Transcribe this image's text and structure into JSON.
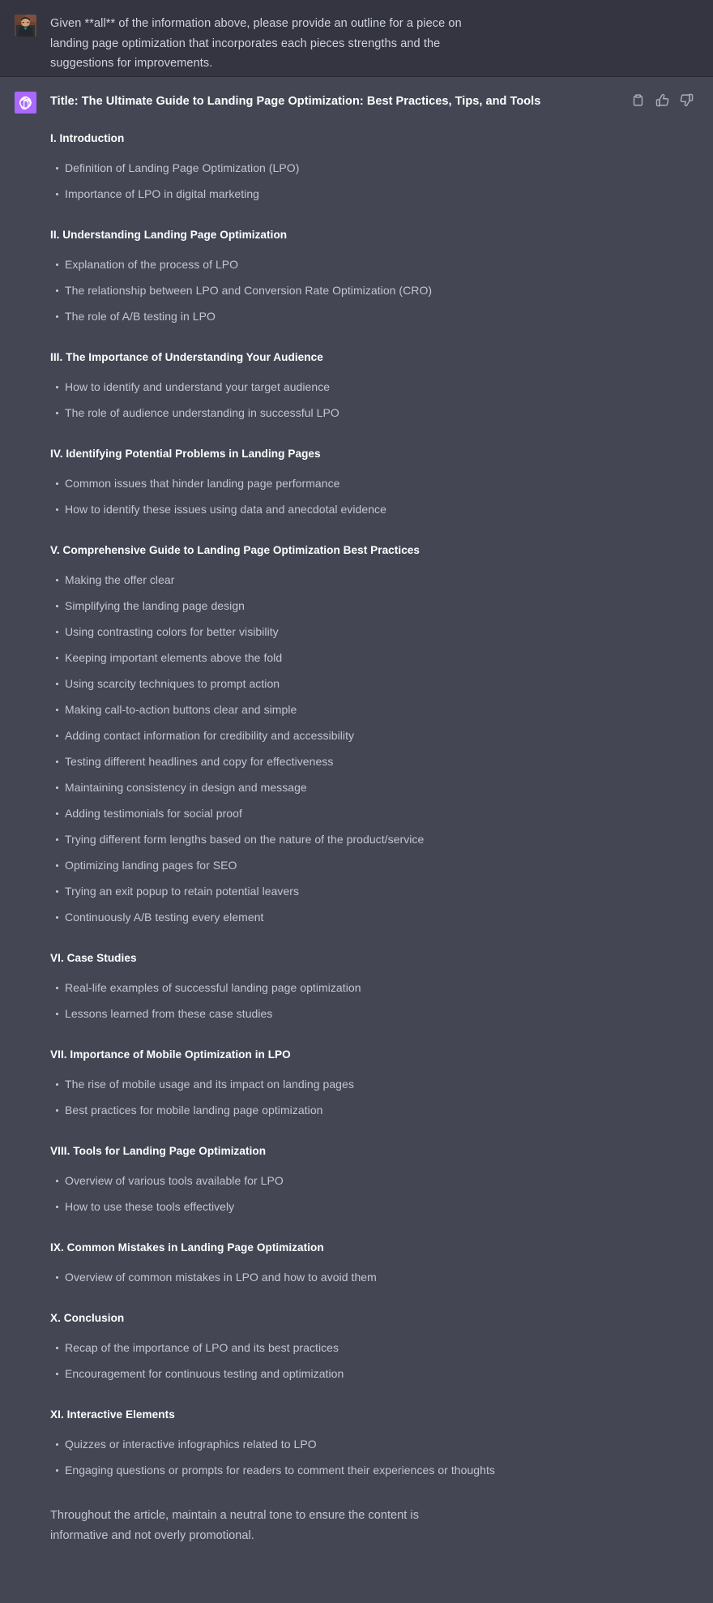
{
  "conversation": {
    "user_message": {
      "avatar_name": "user-avatar-photo",
      "text": "Given **all** of the information above, please provide an outline for a piece on landing page optimization that incorporates each pieces strengths and the suggestions for improvements."
    },
    "assistant_message": {
      "avatar_name": "chatgpt-logo",
      "brand_color": "#ab68ff",
      "title": "Title: The Ultimate Guide to Landing Page Optimization: Best Practices, Tips, and Tools",
      "actions": [
        {
          "name": "copy-icon",
          "label": "Copy"
        },
        {
          "name": "thumbs-up-icon",
          "label": "Good response"
        },
        {
          "name": "thumbs-down-icon",
          "label": "Bad response"
        }
      ],
      "sections": [
        {
          "heading": "I. Introduction",
          "items": [
            "Definition of Landing Page Optimization (LPO)",
            "Importance of LPO in digital marketing"
          ]
        },
        {
          "heading": "II. Understanding Landing Page Optimization",
          "items": [
            "Explanation of the process of LPO",
            "The relationship between LPO and Conversion Rate Optimization (CRO)",
            "The role of A/B testing in LPO"
          ]
        },
        {
          "heading": "III. The Importance of Understanding Your Audience",
          "items": [
            "How to identify and understand your target audience",
            "The role of audience understanding in successful LPO"
          ]
        },
        {
          "heading": "IV. Identifying Potential Problems in Landing Pages",
          "items": [
            "Common issues that hinder landing page performance",
            "How to identify these issues using data and anecdotal evidence"
          ]
        },
        {
          "heading": "V. Comprehensive Guide to Landing Page Optimization Best Practices",
          "items": [
            "Making the offer clear",
            "Simplifying the landing page design",
            "Using contrasting colors for better visibility",
            "Keeping important elements above the fold",
            "Using scarcity techniques to prompt action",
            "Making call-to-action buttons clear and simple",
            "Adding contact information for credibility and accessibility",
            "Testing different headlines and copy for effectiveness",
            "Maintaining consistency in design and message",
            "Adding testimonials for social proof",
            "Trying different form lengths based on the nature of the product/service",
            "Optimizing landing pages for SEO",
            "Trying an exit popup to retain potential leavers",
            "Continuously A/B testing every element"
          ]
        },
        {
          "heading": "VI. Case Studies",
          "items": [
            "Real-life examples of successful landing page optimization",
            "Lessons learned from these case studies"
          ]
        },
        {
          "heading": "VII. Importance of Mobile Optimization in LPO",
          "items": [
            "The rise of mobile usage and its impact on landing pages",
            "Best practices for mobile landing page optimization"
          ]
        },
        {
          "heading": "VIII. Tools for Landing Page Optimization",
          "items": [
            "Overview of various tools available for LPO",
            "How to use these tools effectively"
          ]
        },
        {
          "heading": "IX. Common Mistakes in Landing Page Optimization",
          "items": [
            "Overview of common mistakes in LPO and how to avoid them"
          ]
        },
        {
          "heading": "X. Conclusion",
          "items": [
            "Recap of the importance of LPO and its best practices",
            "Encouragement for continuous testing and optimization"
          ]
        },
        {
          "heading": "XI. Interactive Elements",
          "items": [
            "Quizzes or interactive infographics related to LPO",
            "Engaging questions or prompts for readers to comment their experiences or thoughts"
          ]
        }
      ],
      "closing_paragraph": "Throughout the article, maintain a neutral tone to ensure the content is informative and not overly promotional."
    }
  }
}
